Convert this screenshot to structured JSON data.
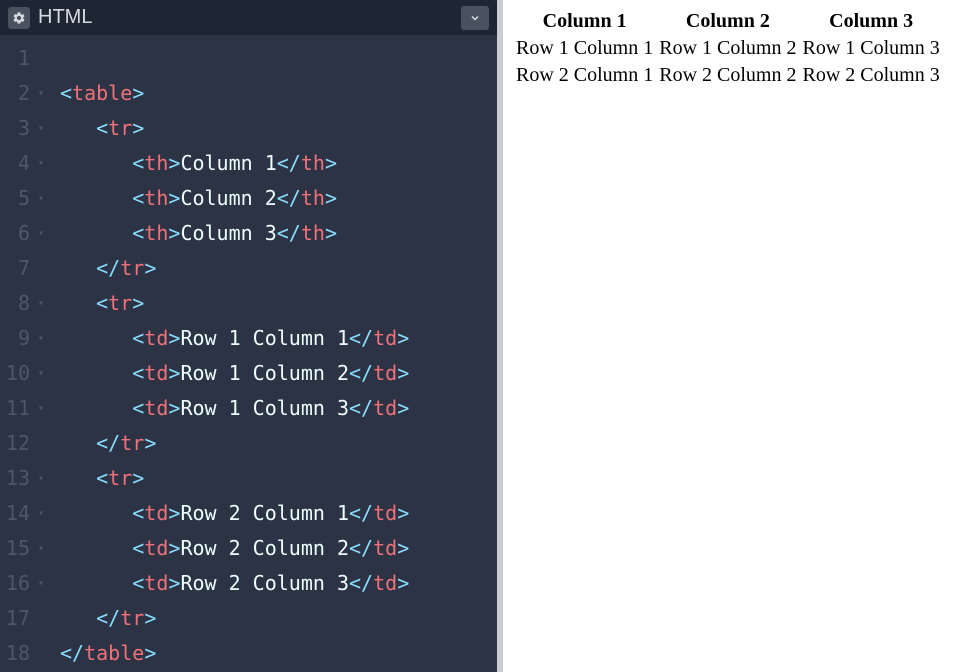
{
  "editor": {
    "title": "HTML",
    "lines": [
      {
        "num": "1",
        "fold": false,
        "tokens": []
      },
      {
        "num": "2",
        "fold": true,
        "tokens": [
          {
            "t": "angle",
            "v": "<"
          },
          {
            "t": "tag",
            "v": "table"
          },
          {
            "t": "angle",
            "v": ">"
          }
        ]
      },
      {
        "num": "3",
        "fold": true,
        "indent": 1,
        "tokens": [
          {
            "t": "angle",
            "v": "<"
          },
          {
            "t": "tag",
            "v": "tr"
          },
          {
            "t": "angle",
            "v": ">"
          }
        ]
      },
      {
        "num": "4",
        "fold": true,
        "indent": 2,
        "tokens": [
          {
            "t": "angle",
            "v": "<"
          },
          {
            "t": "tag",
            "v": "th"
          },
          {
            "t": "angle",
            "v": ">"
          },
          {
            "t": "txt",
            "v": "Column 1"
          },
          {
            "t": "angle",
            "v": "</"
          },
          {
            "t": "tag",
            "v": "th"
          },
          {
            "t": "angle",
            "v": ">"
          }
        ]
      },
      {
        "num": "5",
        "fold": true,
        "indent": 2,
        "tokens": [
          {
            "t": "angle",
            "v": "<"
          },
          {
            "t": "tag",
            "v": "th"
          },
          {
            "t": "angle",
            "v": ">"
          },
          {
            "t": "txt",
            "v": "Column 2"
          },
          {
            "t": "angle",
            "v": "</"
          },
          {
            "t": "tag",
            "v": "th"
          },
          {
            "t": "angle",
            "v": ">"
          }
        ]
      },
      {
        "num": "6",
        "fold": true,
        "indent": 2,
        "tokens": [
          {
            "t": "angle",
            "v": "<"
          },
          {
            "t": "tag",
            "v": "th"
          },
          {
            "t": "angle",
            "v": ">"
          },
          {
            "t": "txt",
            "v": "Column 3"
          },
          {
            "t": "angle",
            "v": "</"
          },
          {
            "t": "tag",
            "v": "th"
          },
          {
            "t": "angle",
            "v": ">"
          }
        ]
      },
      {
        "num": "7",
        "fold": false,
        "indent": 1,
        "tokens": [
          {
            "t": "angle",
            "v": "</"
          },
          {
            "t": "tag",
            "v": "tr"
          },
          {
            "t": "angle",
            "v": ">"
          }
        ]
      },
      {
        "num": "8",
        "fold": true,
        "indent": 1,
        "tokens": [
          {
            "t": "angle",
            "v": "<"
          },
          {
            "t": "tag",
            "v": "tr"
          },
          {
            "t": "angle",
            "v": ">"
          }
        ]
      },
      {
        "num": "9",
        "fold": true,
        "indent": 2,
        "tokens": [
          {
            "t": "angle",
            "v": "<"
          },
          {
            "t": "tag",
            "v": "td"
          },
          {
            "t": "angle",
            "v": ">"
          },
          {
            "t": "txt",
            "v": "Row 1 Column 1"
          },
          {
            "t": "angle",
            "v": "</"
          },
          {
            "t": "tag",
            "v": "td"
          },
          {
            "t": "angle",
            "v": ">"
          }
        ]
      },
      {
        "num": "10",
        "fold": true,
        "indent": 2,
        "tokens": [
          {
            "t": "angle",
            "v": "<"
          },
          {
            "t": "tag",
            "v": "td"
          },
          {
            "t": "angle",
            "v": ">"
          },
          {
            "t": "txt",
            "v": "Row 1 Column 2"
          },
          {
            "t": "angle",
            "v": "</"
          },
          {
            "t": "tag",
            "v": "td"
          },
          {
            "t": "angle",
            "v": ">"
          }
        ]
      },
      {
        "num": "11",
        "fold": true,
        "indent": 2,
        "tokens": [
          {
            "t": "angle",
            "v": "<"
          },
          {
            "t": "tag",
            "v": "td"
          },
          {
            "t": "angle",
            "v": ">"
          },
          {
            "t": "txt",
            "v": "Row 1 Column 3"
          },
          {
            "t": "angle",
            "v": "</"
          },
          {
            "t": "tag",
            "v": "td"
          },
          {
            "t": "angle",
            "v": ">"
          }
        ]
      },
      {
        "num": "12",
        "fold": false,
        "indent": 1,
        "tokens": [
          {
            "t": "angle",
            "v": "</"
          },
          {
            "t": "tag",
            "v": "tr"
          },
          {
            "t": "angle",
            "v": ">"
          }
        ]
      },
      {
        "num": "13",
        "fold": true,
        "indent": 1,
        "tokens": [
          {
            "t": "angle",
            "v": "<"
          },
          {
            "t": "tag",
            "v": "tr"
          },
          {
            "t": "angle",
            "v": ">"
          }
        ]
      },
      {
        "num": "14",
        "fold": true,
        "indent": 2,
        "tokens": [
          {
            "t": "angle",
            "v": "<"
          },
          {
            "t": "tag",
            "v": "td"
          },
          {
            "t": "angle",
            "v": ">"
          },
          {
            "t": "txt",
            "v": "Row 2 Column 1"
          },
          {
            "t": "angle",
            "v": "</"
          },
          {
            "t": "tag",
            "v": "td"
          },
          {
            "t": "angle",
            "v": ">"
          }
        ]
      },
      {
        "num": "15",
        "fold": true,
        "indent": 2,
        "tokens": [
          {
            "t": "angle",
            "v": "<"
          },
          {
            "t": "tag",
            "v": "td"
          },
          {
            "t": "angle",
            "v": ">"
          },
          {
            "t": "txt",
            "v": "Row 2 Column 2"
          },
          {
            "t": "angle",
            "v": "</"
          },
          {
            "t": "tag",
            "v": "td"
          },
          {
            "t": "angle",
            "v": ">"
          }
        ]
      },
      {
        "num": "16",
        "fold": true,
        "indent": 2,
        "tokens": [
          {
            "t": "angle",
            "v": "<"
          },
          {
            "t": "tag",
            "v": "td"
          },
          {
            "t": "angle",
            "v": ">"
          },
          {
            "t": "txt",
            "v": "Row 2 Column 3"
          },
          {
            "t": "angle",
            "v": "</"
          },
          {
            "t": "tag",
            "v": "td"
          },
          {
            "t": "angle",
            "v": ">"
          }
        ]
      },
      {
        "num": "17",
        "fold": false,
        "indent": 1,
        "tokens": [
          {
            "t": "angle",
            "v": "</"
          },
          {
            "t": "tag",
            "v": "tr"
          },
          {
            "t": "angle",
            "v": ">"
          }
        ]
      },
      {
        "num": "18",
        "fold": false,
        "tokens": [
          {
            "t": "angle",
            "v": "</"
          },
          {
            "t": "tag",
            "v": "table"
          },
          {
            "t": "angle",
            "v": ">"
          }
        ]
      }
    ]
  },
  "preview": {
    "headers": [
      "Column 1",
      "Column 2",
      "Column 3"
    ],
    "rows": [
      [
        "Row 1 Column 1",
        "Row 1 Column 2",
        "Row 1 Column 3"
      ],
      [
        "Row 2 Column 1",
        "Row 2 Column 2",
        "Row 2 Column 3"
      ]
    ]
  }
}
